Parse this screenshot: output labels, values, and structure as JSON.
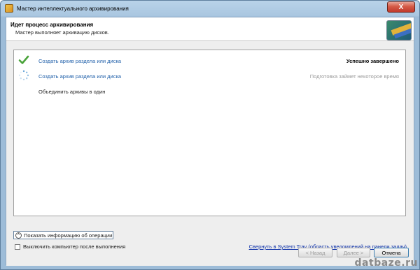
{
  "window": {
    "title": "Мастер интеллектуального архивирования",
    "close_symbol": "X"
  },
  "header": {
    "title": "Идет процесс архивирования",
    "subtitle": "Мастер выполняет архивацию дисков."
  },
  "steps": [
    {
      "label": "Создать архив раздела или диска",
      "status": "Успешно завершено",
      "state": "done",
      "icon": "checkmark-icon"
    },
    {
      "label": "Создать архив раздела или диска",
      "status": "Подготовка займет некоторое время",
      "state": "in-progress",
      "icon": "spinner-icon"
    },
    {
      "label": "Объединить архивы в один",
      "status": "",
      "state": "pending",
      "icon": ""
    }
  ],
  "options": {
    "show_info_label": "Показать информацию об операции",
    "shutdown_label": "Выключить компьютер после выполнения",
    "shutdown_checked": false,
    "tray_link": "Свернуть в System Tray (область уведомлений на панели задач)"
  },
  "buttons": {
    "back": "< Назад",
    "next": "Далее >",
    "cancel": "Отмена"
  },
  "watermark": "datbaze.ru",
  "colors": {
    "link": "#1f5fa9",
    "tray_link": "#0b2fa8",
    "check_green": "#4aa33a"
  }
}
